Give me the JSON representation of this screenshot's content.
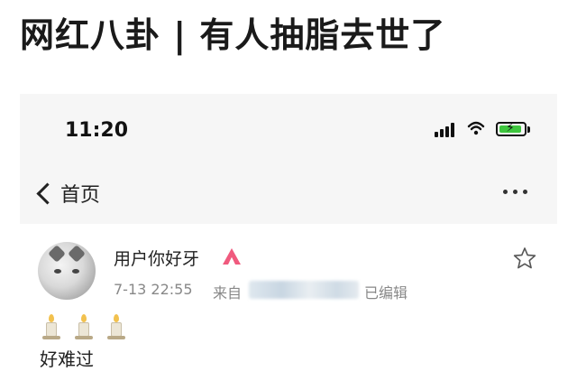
{
  "headline": "网红八卦 | 有人抽脂去世了",
  "status_bar": {
    "time": "11:20",
    "icons": [
      "signal-icon",
      "wifi-icon",
      "battery-charging-icon"
    ],
    "battery_color": "#3ec63e"
  },
  "nav": {
    "back_label": "首页",
    "icons": [
      "back-chevron-icon",
      "more-icon"
    ]
  },
  "post": {
    "username": "用户你好牙",
    "badge_icon": "vip-badge-icon",
    "badge_color": "#f05a7e",
    "timestamp": "7-13 22:55",
    "source_prefix": "来自",
    "edited_label": "已编辑",
    "emoji": [
      "candle-icon",
      "candle-icon",
      "candle-icon"
    ],
    "text": "好难过",
    "favorite_icon": "star-outline-icon"
  }
}
